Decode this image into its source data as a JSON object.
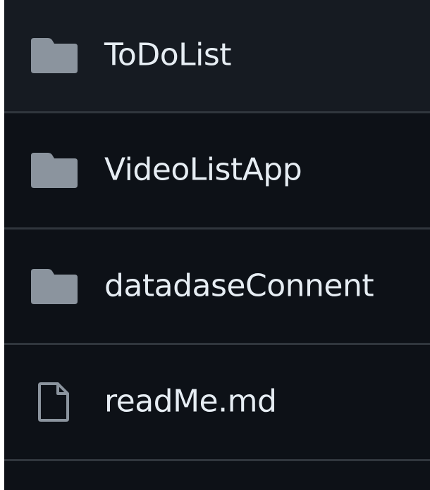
{
  "file_list": {
    "items": [
      {
        "name": "ToDoList",
        "type": "folder",
        "icon": "folder-icon"
      },
      {
        "name": "VideoListApp",
        "type": "folder",
        "icon": "folder-icon"
      },
      {
        "name": "datadaseConnent",
        "type": "folder",
        "icon": "folder-icon"
      },
      {
        "name": "readMe.md",
        "type": "file",
        "icon": "file-icon"
      }
    ]
  },
  "colors": {
    "background": "#0d1117",
    "row_highlight": "#161b22",
    "divider": "#30363d",
    "icon": "#8b949e",
    "text": "#e6edf3"
  }
}
